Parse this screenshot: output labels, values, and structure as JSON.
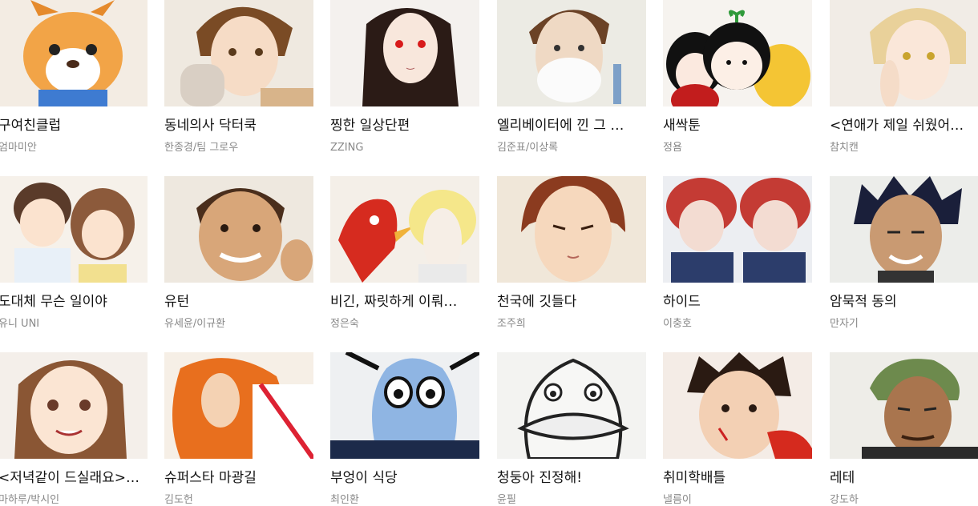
{
  "comics": [
    {
      "title": "구여친클럽",
      "author": "엄마미안",
      "thumb_icon": "fox-character-icon",
      "bg": "#f3ece3"
    },
    {
      "title": "동네의사 닥터쿡",
      "author": "한종경/팀 그로우",
      "thumb_icon": "brown-hair-boy-icon",
      "bg": "#efe9e0"
    },
    {
      "title": "찡한 일상단편",
      "author": "ZZING",
      "thumb_icon": "dark-hair-girl-icon",
      "bg": "#f4f1ee"
    },
    {
      "title": "엘리베이터에 낀 그 …",
      "author": "김준표/이상록",
      "thumb_icon": "shaving-man-icon",
      "bg": "#ecebe4"
    },
    {
      "title": "새싹툰",
      "author": "정욤",
      "thumb_icon": "sprout-characters-icon",
      "bg": "#f6f3ef"
    },
    {
      "title": "<연애가 제일 쉬웠어…",
      "author": "참치캔",
      "thumb_icon": "blonde-boy-icon",
      "bg": "#f1ece6"
    },
    {
      "title": "도대체 무슨 일이야",
      "author": "유니 UNI",
      "thumb_icon": "couple-icon",
      "bg": "#f6f1ea"
    },
    {
      "title": "유턴",
      "author": "유세윤/이규환",
      "thumb_icon": "smiling-man-icon",
      "bg": "#eee8df"
    },
    {
      "title": "비긴, 짜릿하게 이뤄…",
      "author": "정은숙",
      "thumb_icon": "rooster-and-sheep-icon",
      "bg": "#f4efe8"
    },
    {
      "title": "천국에 깃들다",
      "author": "조주희",
      "thumb_icon": "red-hair-boy-icon",
      "bg": "#f0e7d9"
    },
    {
      "title": "하이드",
      "author": "이충호",
      "thumb_icon": "twin-boys-icon",
      "bg": "#eceef2"
    },
    {
      "title": "암묵적 동의",
      "author": "만자기",
      "thumb_icon": "spiky-hair-man-icon",
      "bg": "#ecedea"
    },
    {
      "title": "<저녁같이 드실래요>…",
      "author": "마하루/박시인",
      "thumb_icon": "long-hair-woman-icon",
      "bg": "#f4efea"
    },
    {
      "title": "슈퍼스타 마광길",
      "author": "김도헌",
      "thumb_icon": "orange-hair-man-icon",
      "bg": "#f6efe6"
    },
    {
      "title": "부엉이 식당",
      "author": "최인환",
      "thumb_icon": "owl-icon",
      "bg": "#eef0f2"
    },
    {
      "title": "청둥아 진정해!",
      "author": "윤필",
      "thumb_icon": "duck-icon",
      "bg": "#f3f3f1"
    },
    {
      "title": "취미학배틀",
      "author": "낼름이",
      "thumb_icon": "bloodied-boy-icon",
      "bg": "#f4ece6"
    },
    {
      "title": "레테",
      "author": "강도하",
      "thumb_icon": "beanie-man-icon",
      "bg": "#eeede8"
    }
  ]
}
